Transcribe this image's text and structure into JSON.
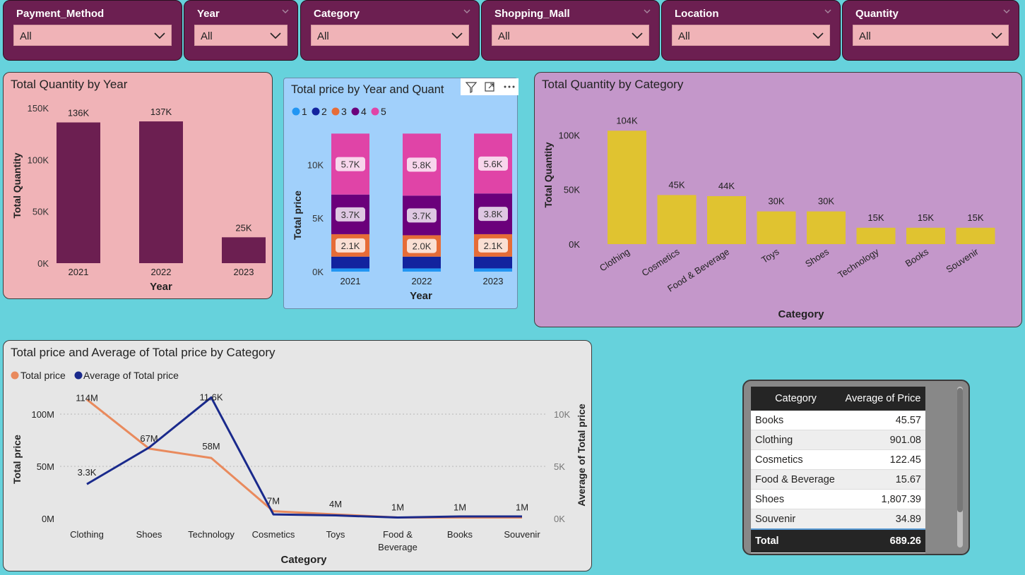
{
  "slicers": [
    {
      "title": "Payment_Method",
      "value": "All"
    },
    {
      "title": "Year",
      "value": "All"
    },
    {
      "title": "Category",
      "value": "All"
    },
    {
      "title": "Shopping_Mall",
      "value": "All"
    },
    {
      "title": "Location",
      "value": "All"
    },
    {
      "title": "Quantity",
      "value": "All"
    }
  ],
  "colors": {
    "background": "#66d2dc",
    "slicer_bg": "#6c1f51",
    "slicer_box": "#f0b3b7",
    "bar_year": "#6c1f51",
    "bar_category": "#e0c330",
    "line_total": "#e98a5d",
    "line_avg": "#1a2a8c",
    "q1": "#2196f3",
    "q2": "#12239e",
    "q3": "#e66c37",
    "q4": "#6b007b",
    "q5": "#e044a7"
  },
  "chart_qty_year": {
    "title": "Total Quantity by Year",
    "xlabel": "Year",
    "ylabel": "Total Quantity",
    "ticks": [
      "0K",
      "50K",
      "100K",
      "150K"
    ]
  },
  "chart_price_year": {
    "title": "Total price by Year and Quant",
    "xlabel": "Year",
    "ylabel": "Total price",
    "ticks": [
      "0K",
      "5K",
      "10K"
    ],
    "legend": [
      "1",
      "2",
      "3",
      "4",
      "5"
    ]
  },
  "chart_qty_category": {
    "title": "Total Quantity by Category",
    "xlabel": "Category",
    "ylabel": "Total Quantity",
    "ticks": [
      "0K",
      "50K",
      "100K"
    ]
  },
  "chart_combo": {
    "title": "Total price and Average of Total price by Category",
    "xlabel": "Category",
    "ylabel_left": "Total price",
    "ylabel_right": "Average of Total price",
    "legend": [
      "Total price",
      "Average of Total price"
    ],
    "ticks_left": [
      "0M",
      "50M",
      "100M"
    ],
    "ticks_right": [
      "0K",
      "5K",
      "10K"
    ]
  },
  "table": {
    "headers": [
      "Category",
      "Average of Price"
    ],
    "rows": [
      [
        "Books",
        "45.57"
      ],
      [
        "Clothing",
        "901.08"
      ],
      [
        "Cosmetics",
        "122.45"
      ],
      [
        "Food & Beverage",
        "15.67"
      ],
      [
        "Shoes",
        "1,807.39"
      ],
      [
        "Souvenir",
        "34.89"
      ]
    ],
    "total": [
      "Total",
      "689.26"
    ]
  },
  "chart_data": [
    {
      "type": "bar",
      "title": "Total Quantity by Year",
      "categories": [
        "2021",
        "2022",
        "2023"
      ],
      "values": [
        136000,
        137000,
        25000
      ],
      "labels": [
        "136K",
        "137K",
        "25K"
      ],
      "xlabel": "Year",
      "ylabel": "Total Quantity",
      "ylim": [
        0,
        150000
      ]
    },
    {
      "type": "bar",
      "stacked": true,
      "title": "Total price by Year and Quant",
      "categories": [
        "2021",
        "2022",
        "2023"
      ],
      "series": [
        {
          "name": "1",
          "values": [
            300,
            300,
            300
          ]
        },
        {
          "name": "2",
          "values": [
            1100,
            1100,
            1100
          ]
        },
        {
          "name": "3",
          "values": [
            2100,
            2000,
            2100
          ]
        },
        {
          "name": "4",
          "values": [
            3700,
            3700,
            3800
          ]
        },
        {
          "name": "5",
          "values": [
            5700,
            5800,
            5600
          ]
        }
      ],
      "labels": {
        "3": [
          "2.1K",
          "2.0K",
          "2.1K"
        ],
        "4": [
          "3.7K",
          "3.7K",
          "3.8K"
        ],
        "5": [
          "5.7K",
          "5.8K",
          "5.6K"
        ]
      },
      "xlabel": "Year",
      "ylabel": "Total price",
      "ylim": [
        0,
        12000
      ]
    },
    {
      "type": "bar",
      "title": "Total Quantity by Category",
      "categories": [
        "Clothing",
        "Cosmetics",
        "Food & Beverage",
        "Toys",
        "Shoes",
        "Technology",
        "Books",
        "Souvenir"
      ],
      "values": [
        104000,
        45000,
        44000,
        30000,
        30000,
        15000,
        15000,
        15000
      ],
      "labels": [
        "104K",
        "45K",
        "44K",
        "30K",
        "30K",
        "15K",
        "15K",
        "15K"
      ],
      "xlabel": "Category",
      "ylabel": "Total Quantity",
      "ylim": [
        0,
        110000
      ]
    },
    {
      "type": "line",
      "title": "Total price and Average of Total price by Category",
      "categories": [
        "Clothing",
        "Shoes",
        "Technology",
        "Cosmetics",
        "Toys",
        "Food & Beverage",
        "Books",
        "Souvenir"
      ],
      "series": [
        {
          "name": "Total price",
          "axis": "left",
          "values": [
            114,
            67,
            58,
            7,
            4,
            1,
            1,
            1
          ],
          "labels": [
            "114M",
            "67M",
            "58M",
            "7M",
            "4M",
            "1M",
            "1M",
            "1M"
          ]
        },
        {
          "name": "Average of Total price",
          "axis": "right",
          "values": [
            3.3,
            6.8,
            11.6,
            0.4,
            0.3,
            0.1,
            0.2,
            0.2
          ],
          "labels": [
            "3.3K",
            "",
            "11.6K",
            "",
            "",
            "",
            "",
            ""
          ]
        }
      ],
      "xlabel": "Category",
      "ylabel": "Total price",
      "ylabel_right": "Average of Total price",
      "ylim_left": [
        0,
        120
      ],
      "ylim_right": [
        0,
        12
      ]
    }
  ]
}
